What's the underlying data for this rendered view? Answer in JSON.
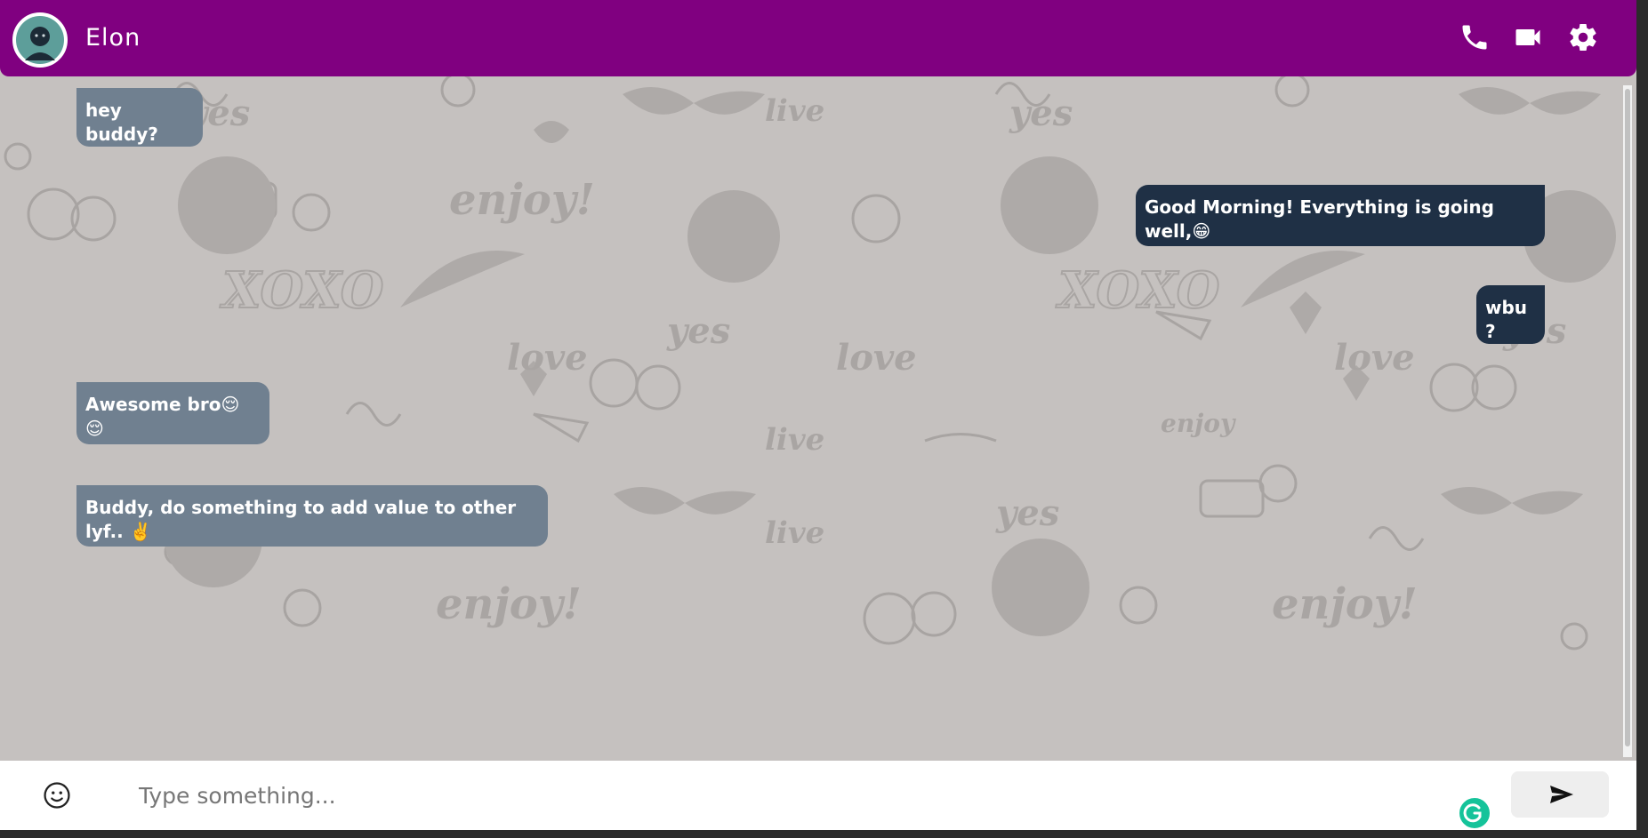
{
  "header": {
    "contact_name": "Elon",
    "icons": [
      "avatar",
      "phone-icon",
      "video-camera-icon",
      "gear-icon"
    ]
  },
  "messages": [
    {
      "direction": "incoming",
      "text": "hey buddy?"
    },
    {
      "direction": "outgoing",
      "text": "Good Morning! Everything is going well,😁"
    },
    {
      "direction": "outgoing",
      "text": "wbu ?"
    },
    {
      "direction": "incoming",
      "text": "Awesome bro😌 😌"
    },
    {
      "direction": "incoming",
      "text": "Buddy, do something to add value to other lyf.. ✌️"
    }
  ],
  "composer": {
    "placeholder": "Type something...",
    "value": "",
    "icons": [
      "smiley-icon",
      "send-icon",
      "grammarly-icon"
    ]
  },
  "colors": {
    "header": "#800080",
    "incoming_bubble": "#708090",
    "outgoing_bubble": "#1f3045",
    "wallpaper": "#c5c1bf"
  }
}
